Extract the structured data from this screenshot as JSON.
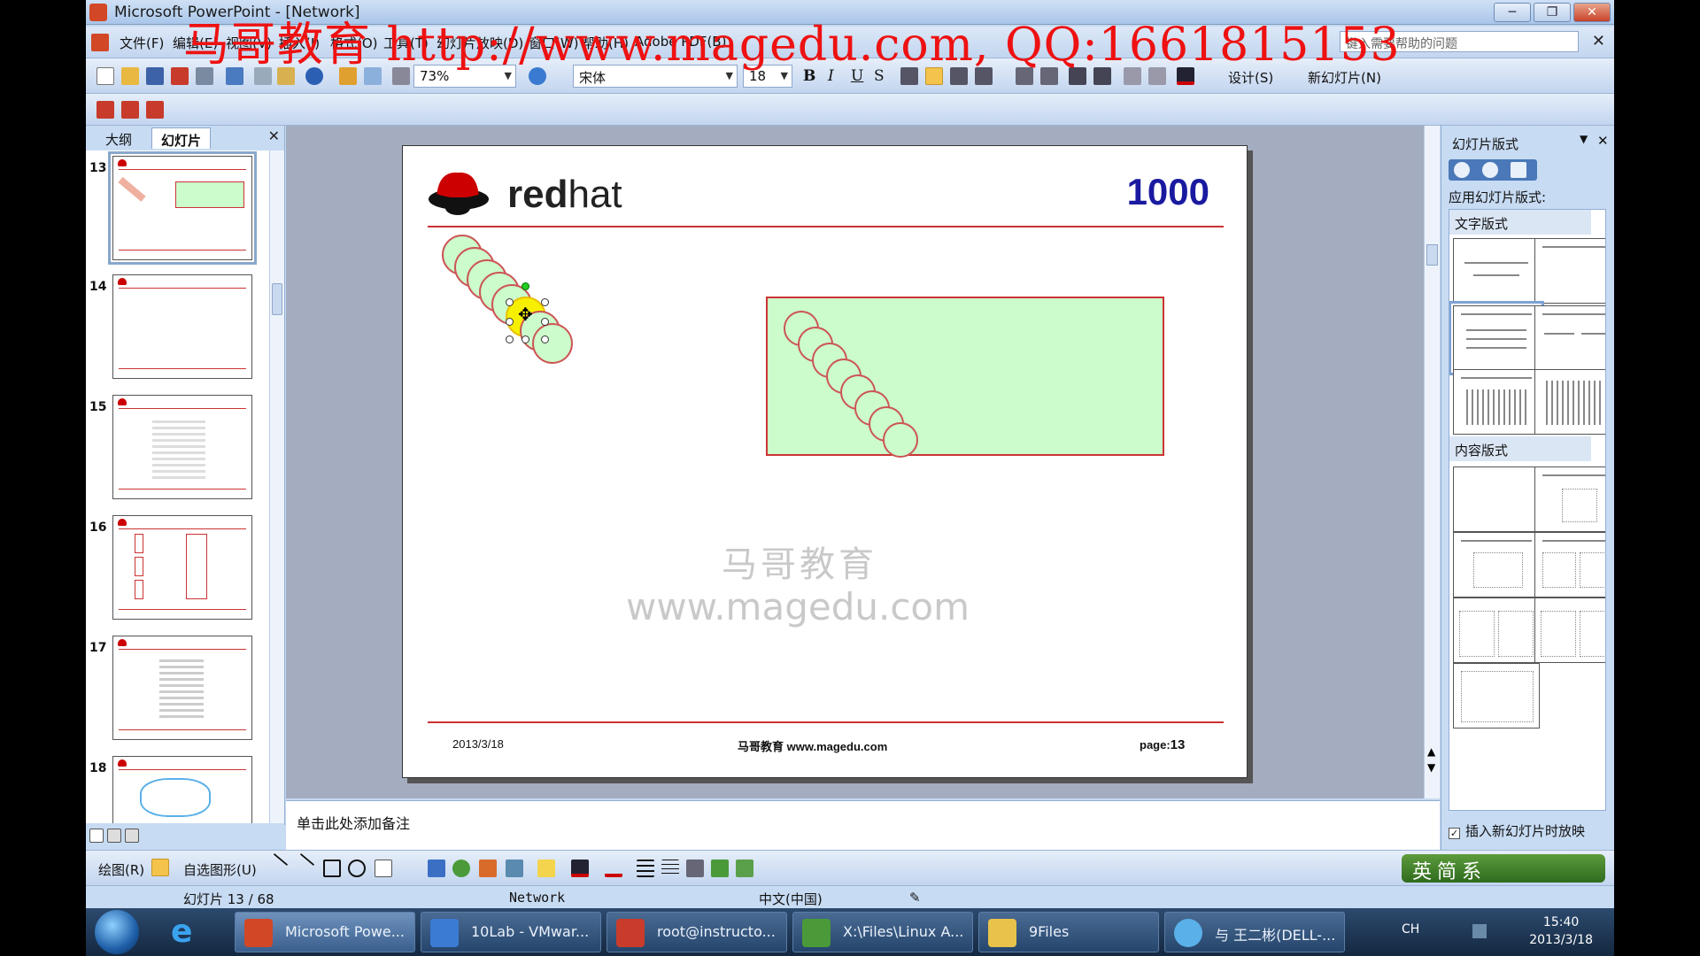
{
  "window": {
    "title": "Microsoft PowerPoint - [Network]",
    "buttons": [
      "─",
      "❐",
      "✕"
    ]
  },
  "banner": "马哥教育 http://www.magedu.com, QQ:1661815153",
  "menu": {
    "items": [
      "文件(F)",
      "编辑(E)",
      "视图(V)",
      "插入(I)",
      "格式(O)",
      "工具(T)",
      "幻灯片放映(D)",
      "窗口(W)",
      "帮助(H)",
      "Adobe PDF(B)"
    ],
    "help_placeholder": "键入需要帮助的问题"
  },
  "toolbar": {
    "zoom": "73%",
    "font": "宋体",
    "font_size": "18",
    "bold": "B",
    "italic": "I",
    "underline": "U",
    "shadow": "S",
    "design": "设计(S)",
    "new_slide": "新幻灯片(N)"
  },
  "left_panel": {
    "tab_outline": "大纲",
    "tab_slides": "幻灯片",
    "close": "✕",
    "thumbnails": [
      {
        "num": "13"
      },
      {
        "num": "14"
      },
      {
        "num": "15"
      },
      {
        "num": "16"
      },
      {
        "num": "17"
      },
      {
        "num": "18"
      }
    ]
  },
  "slide": {
    "brand": "redhat",
    "brand_bold": "red",
    "brand_light": "hat",
    "number_big": "1000",
    "date": "2013/3/18",
    "footer_center": "马哥教育 www.magedu.com",
    "page_label": "page:",
    "page_num": "13",
    "watermark_cn": "马哥教育",
    "watermark_url": "www.magedu.com"
  },
  "notes": {
    "placeholder": "单击此处添加备注"
  },
  "task_pane": {
    "title": "幻灯片版式",
    "apply_label": "应用幻灯片版式:",
    "section_text": "文字版式",
    "section_content": "内容版式",
    "show_on_insert": "插入新幻灯片时放映",
    "show_on_insert_checked": true
  },
  "draw_toolbar": {
    "draw": "绘图(R)",
    "autoshapes": "自选图形(U)",
    "ime": "英简系"
  },
  "status": {
    "slide_pos": "幻灯片 13 / 68",
    "template": "Network",
    "language": "中文(中国)"
  },
  "taskbar": {
    "tasks": [
      {
        "label": "Microsoft Powe...",
        "color": "#d24726"
      },
      {
        "label": "10Lab - VMwar...",
        "color": "#3b7bd4"
      },
      {
        "label": "root@instructo...",
        "color": "#c93c2c"
      },
      {
        "label": "X:\\Files\\Linux A...",
        "color": "#4a9a3a"
      },
      {
        "label": "9Files",
        "color": "#e8c24a"
      },
      {
        "label": "与 王二彬(DELL-...",
        "color": "#5ab0e8"
      }
    ],
    "ime_lang": "CH",
    "time": "15:40",
    "date": "2013/3/18"
  }
}
